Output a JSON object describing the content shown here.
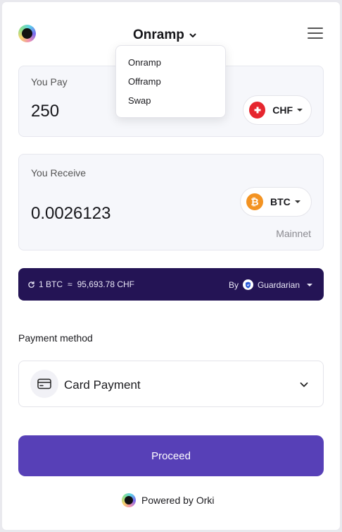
{
  "header": {
    "mode_label": "Onramp",
    "logo_icon": "orki-logo-icon",
    "menu_icon": "hamburger-menu-icon"
  },
  "mode_dropdown": {
    "items": [
      "Onramp",
      "Offramp",
      "Swap"
    ]
  },
  "pay": {
    "label": "You Pay",
    "amount": "250",
    "currency": "CHF",
    "currency_icon": "swiss-flag-icon",
    "currency_color": "#e6262e"
  },
  "receive": {
    "label": "You Receive",
    "amount": "0.0026123",
    "currency": "BTC",
    "currency_icon": "bitcoin-icon",
    "currency_color": "#f39322",
    "network": "Mainnet"
  },
  "rate": {
    "text": "1 BTC",
    "approx": "≈",
    "value": "95,693.78 CHF",
    "by_label": "By",
    "provider": "Guardarian",
    "background_color": "#241455"
  },
  "payment": {
    "label": "Payment method",
    "selected": "Card Payment",
    "icon": "credit-card-icon"
  },
  "proceed_button": {
    "label": "Proceed",
    "color": "#5740b7"
  },
  "footer": {
    "powered_text": "Powered by Orki"
  }
}
